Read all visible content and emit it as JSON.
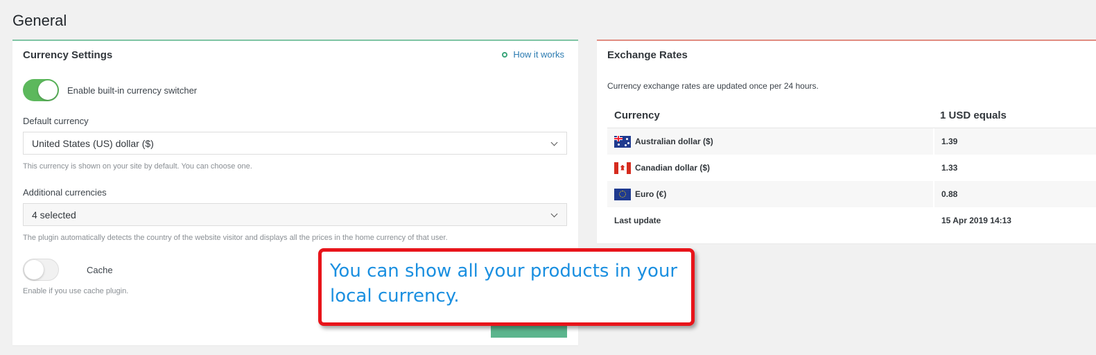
{
  "page": {
    "title": "General"
  },
  "currency_settings": {
    "title": "Currency Settings",
    "how_it_works": "How it works",
    "enable_switcher": {
      "label": "Enable built-in currency switcher",
      "on": true
    },
    "default_currency": {
      "label": "Default currency",
      "value": "United States (US) dollar ($)",
      "hint": "This currency is shown on your site by default. You can choose one."
    },
    "additional_currencies": {
      "label": "Additional currencies",
      "value": "4 selected",
      "hint": "The plugin automatically detects the country of the website visitor and displays all the prices in the home currency of that user."
    },
    "cache": {
      "label": "Cache",
      "on": false,
      "hint": "Enable if you use cache plugin."
    }
  },
  "exchange_rates": {
    "title": "Exchange Rates",
    "description": "Currency exchange rates are updated once per 24 hours.",
    "columns": [
      "Currency",
      "1 USD equals"
    ],
    "rows": [
      {
        "flag": "australia-flag-icon",
        "currency": "Australian dollar ($)",
        "rate": "1.39"
      },
      {
        "flag": "canada-flag-icon",
        "currency": "Canadian dollar ($)",
        "rate": "1.33"
      },
      {
        "flag": "eu-flag-icon",
        "currency": "Euro (€)",
        "rate": "0.88"
      }
    ],
    "last_update": {
      "label": "Last update",
      "value": "15 Apr 2019 14:13"
    }
  },
  "callout": {
    "text": "You can show all your products in your local currency."
  },
  "colors": {
    "toggle_on": "#5cb85c",
    "left_card_accent": "#7ec4a4",
    "right_card_accent": "#e08c80",
    "callout_border": "#e8141a",
    "callout_text": "#1a8fe0",
    "link": "#2a7ab0"
  }
}
